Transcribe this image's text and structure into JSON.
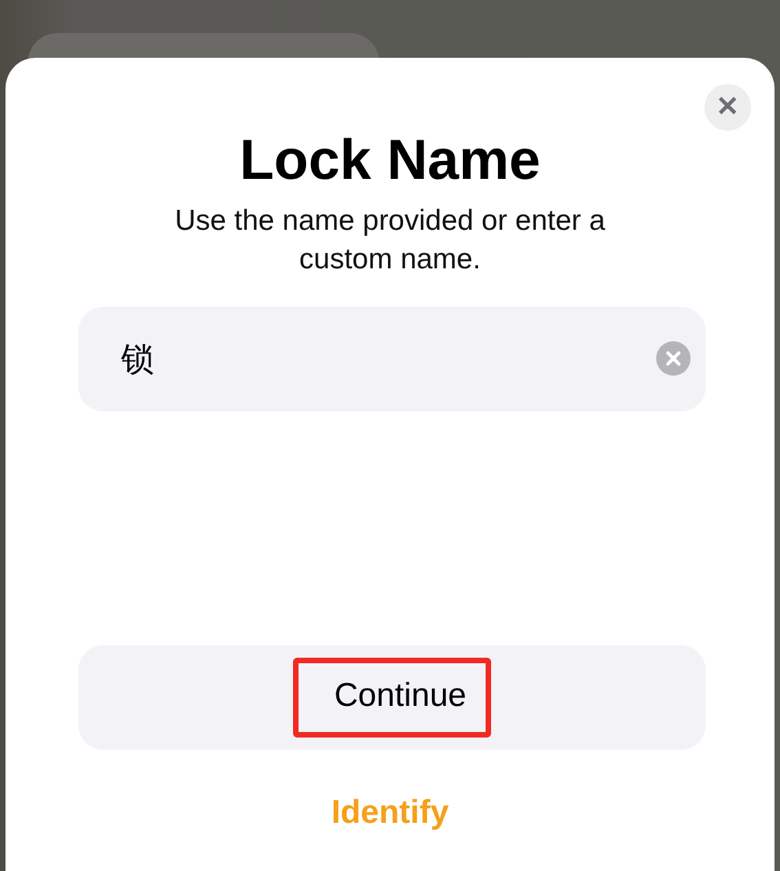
{
  "sheet": {
    "title": "Lock Name",
    "subtitle": "Use the name provided or enter a custom name.",
    "close_button": {
      "label": "✕"
    }
  },
  "name_field": {
    "value": "锁"
  },
  "continue_button": {
    "label": "Continue",
    "highlighted": true
  },
  "identify_link": {
    "label": "Identify"
  }
}
